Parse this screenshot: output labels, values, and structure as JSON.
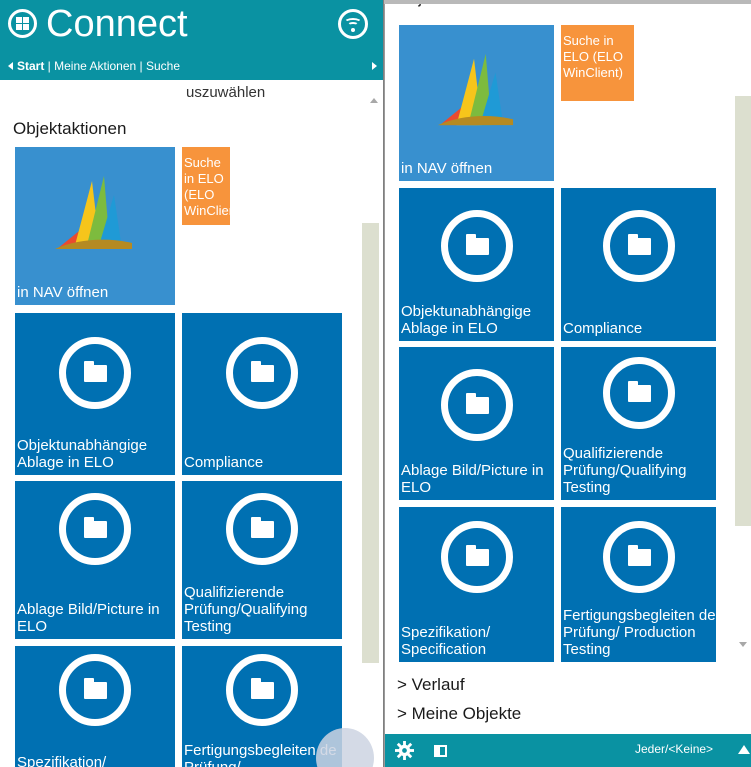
{
  "header": {
    "brand": "Connect",
    "breadcrumb_start": "Start",
    "breadcrumb_rest": " | Meine Aktionen | Suche"
  },
  "left": {
    "cut_text": "uszuwählen",
    "section_title": "Objektaktionen",
    "tiles": {
      "nav": "in NAV öffnen",
      "elo_search": "Suche in ELO (ELO WinClient)",
      "objekt_ablage": "Objektunabhängige Ablage in ELO",
      "compliance": "Compliance",
      "ablage_bild": "Ablage Bild/Picture in ELO",
      "qualifying": "Qualifizierende Prüfung/Qualifying Testing",
      "spezifikation": "Spezifikation/",
      "fertigung": "Fertigungsbegleiten de Prüfung/"
    }
  },
  "right": {
    "section_title": "Objektaktionen",
    "tiles": {
      "nav": "in NAV öffnen",
      "elo_search": "Suche in ELO (ELO WinClient)",
      "objekt_ablage": "Objektunabhängige Ablage in ELO",
      "compliance": "Compliance",
      "ablage_bild": "Ablage Bild/Picture in ELO",
      "qualifying": "Qualifizierende Prüfung/Qualifying Testing",
      "spezifikation": "Spezifikation/ Specification",
      "fertigung": "Fertigungsbegleiten de Prüfung/ Production Testing"
    },
    "links": {
      "verlauf": "> Verlauf",
      "meine_objekte": "> Meine Objekte"
    },
    "footer": {
      "status": "Jeder/<Keine>"
    }
  },
  "colors": {
    "header_teal": "#0a92a2",
    "tile_blue": "#0070b2",
    "tile_nav_blue": "#3890cf",
    "tile_orange": "#f7943c",
    "scroll_track": "#dcdfcf"
  },
  "icons": [
    "connect-logo-icon",
    "wifi-icon",
    "folder-icon",
    "dynamics-nav-logo-icon",
    "gear-icon",
    "layout-icon",
    "triangle-left-icon",
    "triangle-right-icon",
    "triangle-up-icon"
  ]
}
